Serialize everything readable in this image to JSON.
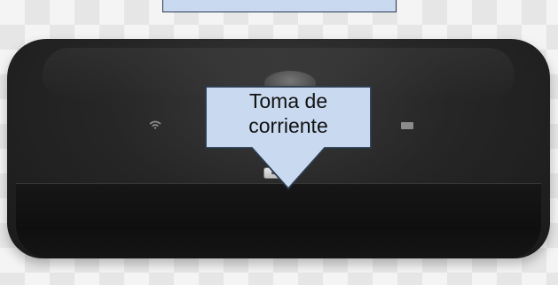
{
  "callout": {
    "label_line1": "Toma de",
    "label_line2": "corriente"
  },
  "icons": {
    "wifi": "wifi-icon",
    "signal": "signal-icon",
    "message": "message-icon",
    "battery": "battery-icon"
  },
  "colors": {
    "callout_fill": "#c9daf0",
    "callout_border": "#2b3a4f",
    "router_body": "#1f1f1f"
  }
}
